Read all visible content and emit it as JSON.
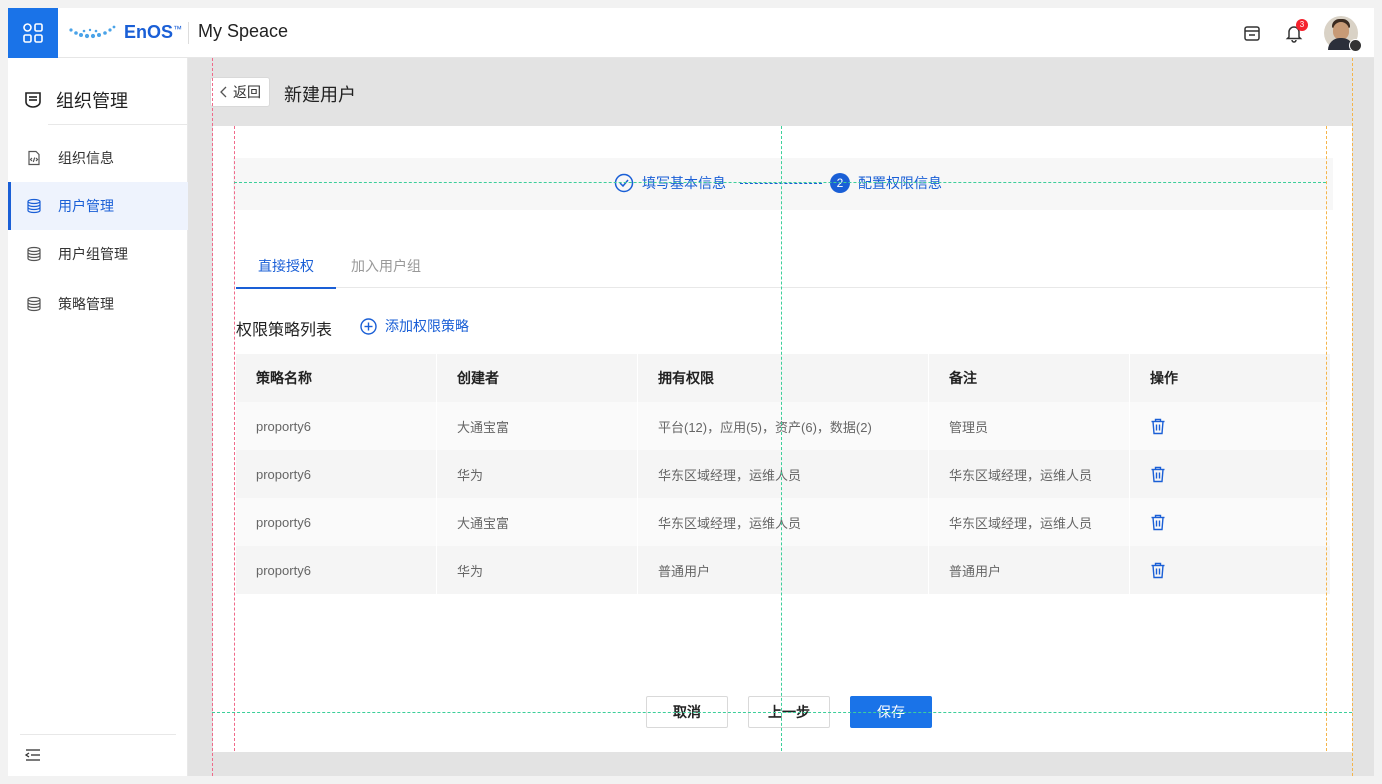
{
  "topbar": {
    "logo_text": "EnOS",
    "logo_tm": "™",
    "workspace": "My Speace",
    "notification_count": "3"
  },
  "sidebar": {
    "title": "组织管理",
    "items": [
      {
        "label": "组织信息",
        "icon": "file-code-icon",
        "active": false
      },
      {
        "label": "用户管理",
        "icon": "database-icon",
        "active": true
      },
      {
        "label": "用户组管理",
        "icon": "database-icon",
        "active": false
      },
      {
        "label": "策略管理",
        "icon": "database-icon",
        "active": false
      }
    ]
  },
  "page": {
    "back_label": "返回",
    "title": "新建用户"
  },
  "steps": [
    {
      "label": "填写基本信息",
      "status": "done"
    },
    {
      "label": "配置权限信息",
      "number": "2",
      "status": "current"
    }
  ],
  "tabs": [
    {
      "label": "直接授权",
      "active": true
    },
    {
      "label": "加入用户组",
      "active": false
    }
  ],
  "policy_list": {
    "title": "权限策略列表",
    "add_label": "添加权限策略",
    "columns": [
      "策略名称",
      "创建者",
      "拥有权限",
      "备注",
      "操作"
    ],
    "rows": [
      {
        "name": "proporty6",
        "creator": "大通宝富",
        "permissions": "平台(12)，应用(5)，资产(6)，数据(2)",
        "note": "管理员"
      },
      {
        "name": "proporty6",
        "creator": "华为",
        "permissions": "华东区域经理，运维人员",
        "note": "华东区域经理，运维人员"
      },
      {
        "name": "proporty6",
        "creator": "大通宝富",
        "permissions": "华东区域经理，运维人员",
        "note": "华东区域经理，运维人员"
      },
      {
        "name": "proporty6",
        "creator": "华为",
        "permissions": "普通用户",
        "note": "普通用户"
      }
    ]
  },
  "footer": {
    "cancel_label": "取消",
    "prev_label": "上一步",
    "save_label": "保存"
  },
  "colors": {
    "accent": "#1a73e8",
    "link": "#1a5fd6",
    "badge": "#f5222d"
  }
}
